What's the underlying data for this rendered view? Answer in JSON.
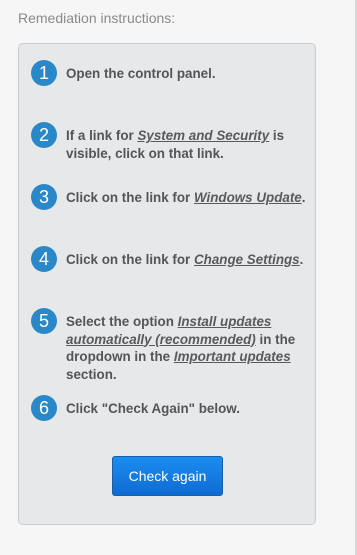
{
  "title": "Remediation instructions:",
  "steps": [
    {
      "number": "1",
      "parts": [
        {
          "t": "Open the control panel."
        }
      ]
    },
    {
      "number": "2",
      "parts": [
        {
          "t": "If a link for "
        },
        {
          "t": "System and Security",
          "link": true
        },
        {
          "t": " is visible, click on that link."
        }
      ]
    },
    {
      "number": "3",
      "parts": [
        {
          "t": "Click on the link for "
        },
        {
          "t": "Windows Update",
          "link": true
        },
        {
          "t": "."
        }
      ]
    },
    {
      "number": "4",
      "parts": [
        {
          "t": "Click on the link for "
        },
        {
          "t": "Change Settings",
          "link": true
        },
        {
          "t": "."
        }
      ]
    },
    {
      "number": "5",
      "parts": [
        {
          "t": "Select the option "
        },
        {
          "t": "Install updates automatically (recommended)",
          "link": true
        },
        {
          "t": " in the dropdown in the "
        },
        {
          "t": "Important updates",
          "link": true
        },
        {
          "t": " section."
        }
      ]
    },
    {
      "number": "6",
      "parts": [
        {
          "t": "Click \"Check Again\" below."
        }
      ]
    }
  ],
  "button": {
    "label": "Check again"
  },
  "colors": {
    "step_badge": "#2b88c8",
    "button": "#1478e0",
    "panel_bg": "#e7e8ea"
  }
}
